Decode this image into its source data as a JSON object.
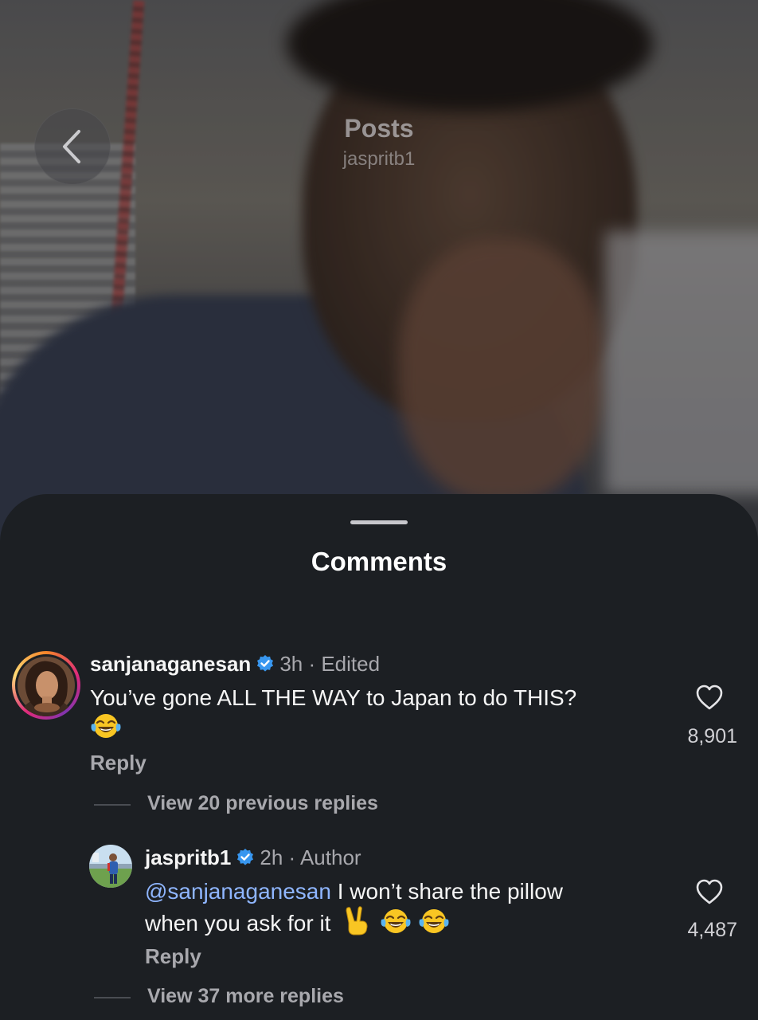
{
  "nav": {
    "title": "Posts",
    "subtitle": "jaspritb1",
    "back_icon": "chevron-left-icon"
  },
  "sheet": {
    "title": "Comments"
  },
  "comments": [
    {
      "username": "sanjanaganesan",
      "verified": true,
      "time": "3h",
      "status": "Edited",
      "text": "You’ve gone ALL THE WAY to Japan to do THIS?",
      "emojis": [
        "face-with-tears-of-joy"
      ],
      "likes": "8,901",
      "reply_label": "Reply",
      "view_replies": "View 20 previous replies"
    },
    {
      "username": "jaspritb1",
      "verified": true,
      "time": "2h",
      "status": "Author",
      "mention": "@sanjanaganesan",
      "text_line1": " I won’t share the pillow",
      "text_line2": "when you ask for it",
      "emojis": [
        "victory-hand",
        "face-with-tears-of-joy",
        "face-with-tears-of-joy"
      ],
      "likes": "4,487",
      "reply_label": "Reply",
      "view_replies": "View 37 more replies"
    }
  ],
  "colors": {
    "sheet_bg": "#1c1f23",
    "text_primary": "#f5f5f5",
    "text_secondary": "#a8a8ad",
    "mention": "#8fb6ff",
    "verified_badge": "#3897f0"
  }
}
